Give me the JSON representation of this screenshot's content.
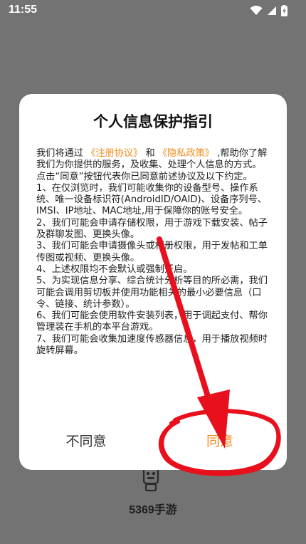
{
  "status_bar": {
    "time": "11:55",
    "icons": [
      "wifi-icon",
      "signal-icon",
      "battery-charging-icon"
    ]
  },
  "dialog": {
    "title": "个人信息保护指引",
    "intro_prefix": "我们将通过",
    "register_link": "《注册协议》",
    "and": "和",
    "privacy_link": "《隐私政策》",
    "intro_suffix": ",帮助你了解我们为你提供的服务，及收集、处理个人信息的方式。",
    "consent_line": "点击“同意”按钮代表你已同意前述协议及以下约定。",
    "items": [
      "1、在仅浏览时，我们可能收集你的设备型号、操作系统、唯一设备标识符(AndroidID/OAID)、设备序列号、IMSI、IP地址、MAC地址,用于保障你的账号安全。",
      "2、我们可能会申请存储权限，用于游戏下载安装、帖子及群聊发图、更换头像。",
      "3、我们可能会申请摄像头或相册权限，用于发帖和工单传图或视频、更换头像。",
      "4、上述权限均不会默认或强制开启。",
      "5、为实现信息分享、综合统计分析等目的所必需，我们可能会调用剪切板并使用功能相关的最小必要信息（口令、链接、统计参数）。",
      "6、我们可能会使用软件安装列表，用于调起支付、帮你管理装在手机的本平台游戏。",
      "7、我们可能会收集加速度传感器信息，用于播放视频时旋转屏幕。"
    ],
    "disagree_label": "不同意",
    "agree_label": "同意"
  },
  "background": {
    "app_logo_icon": "app-logo-icon",
    "app_name": "5369手游"
  },
  "colors": {
    "accent": "#f08c1c",
    "annotation_red": "#e8101c",
    "overlay": "#737373"
  }
}
